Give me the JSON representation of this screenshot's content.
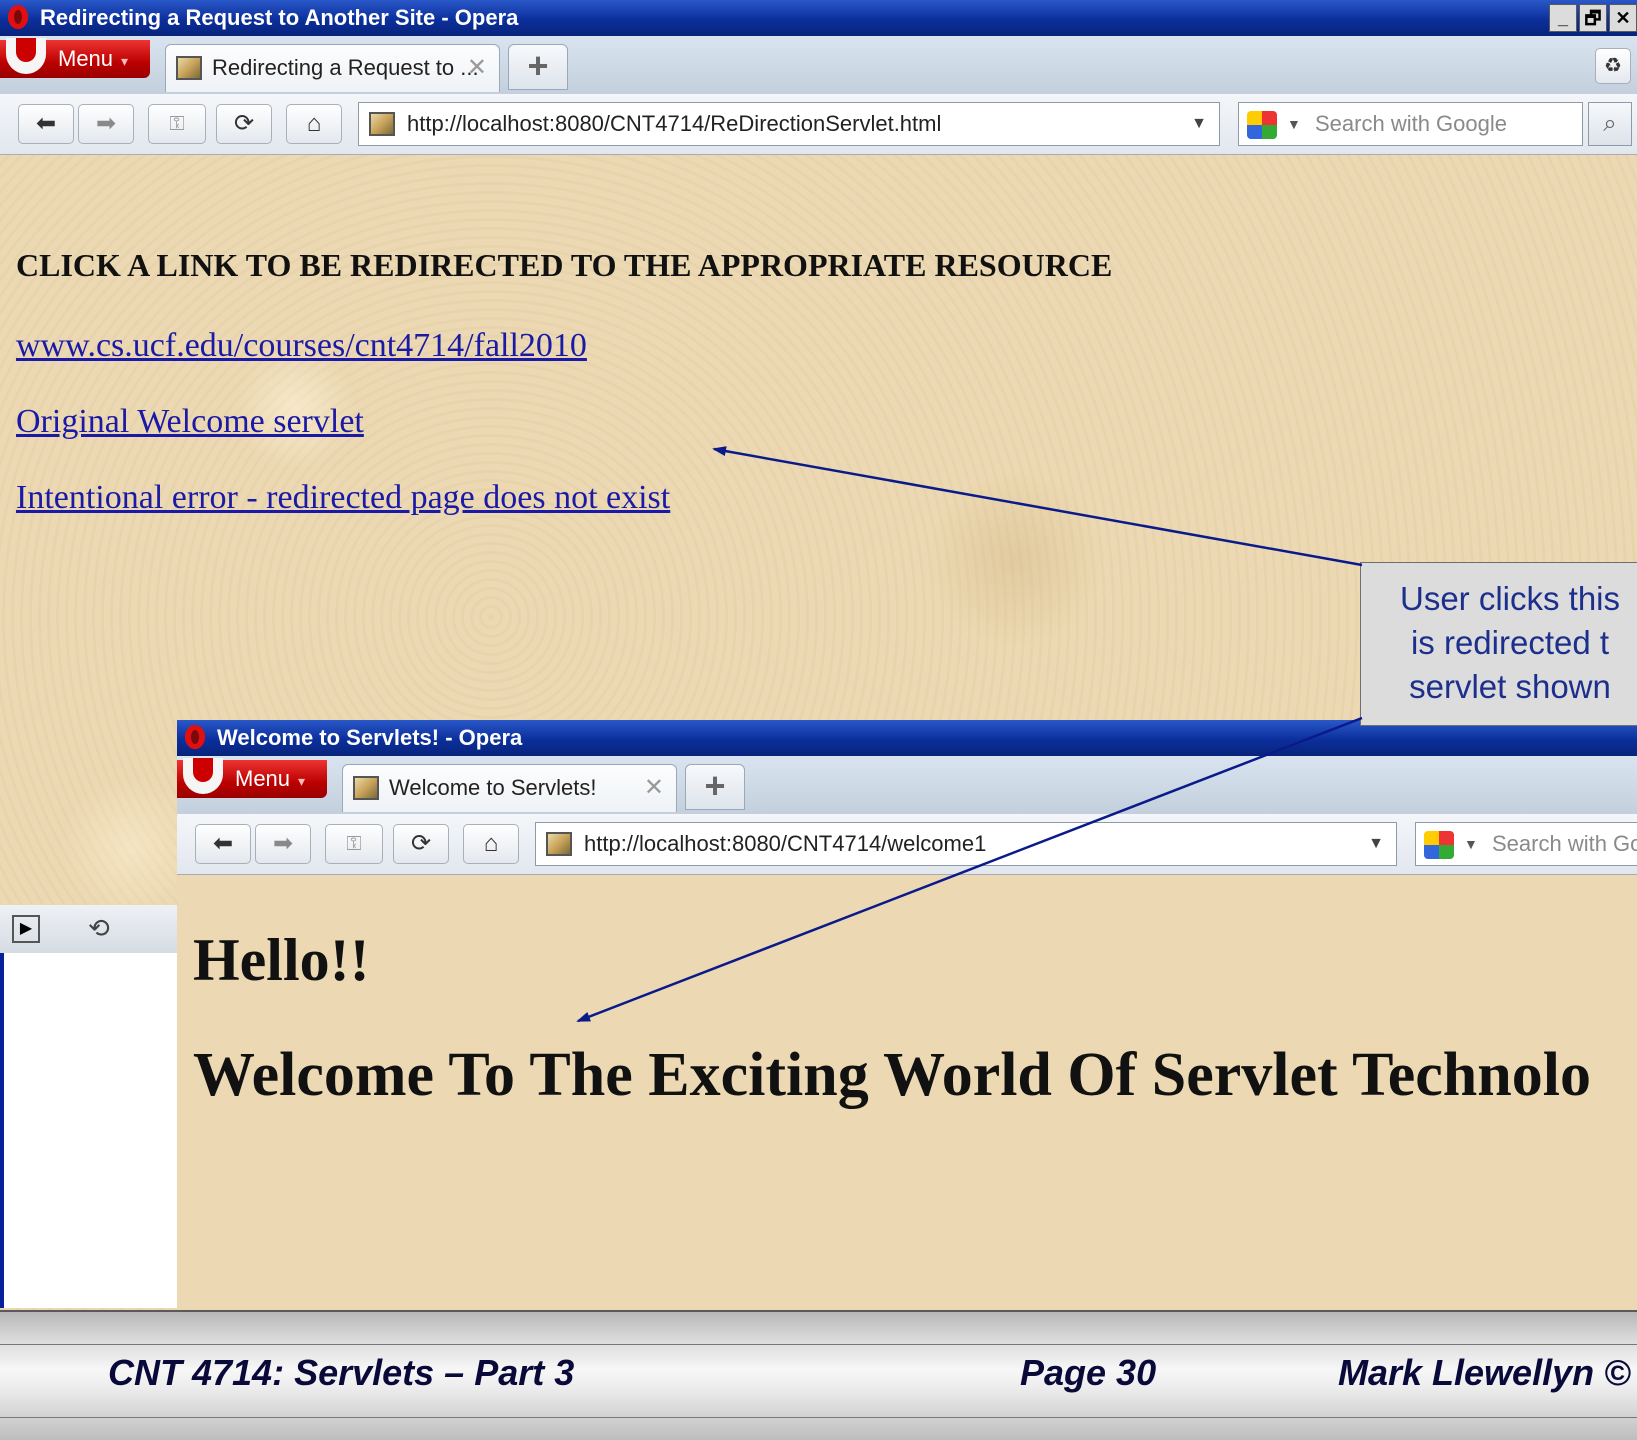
{
  "window1": {
    "title": "Redirecting a Request to Another Site - Opera",
    "window_buttons": [
      "_",
      "🗗",
      "✕"
    ],
    "menu_label": "Menu",
    "tab_title": "Redirecting a Request to ...",
    "address": "http://localhost:8080/CNT4714/ReDirectionServlet.html",
    "search_placeholder": "Search with Google",
    "heading": "CLICK A LINK TO BE REDIRECTED TO THE APPROPRIATE RESOURCE",
    "links": [
      "www.cs.ucf.edu/courses/cnt4714/fall2010",
      "Original Welcome servlet",
      "Intentional error - redirected page does not exist"
    ]
  },
  "callout": {
    "lines": [
      "User clicks this",
      "is redirected t",
      "servlet shown"
    ]
  },
  "window2": {
    "title": "Welcome to Servlets! - Opera",
    "menu_label": "Menu",
    "tab_title": "Welcome to Servlets!",
    "address": "http://localhost:8080/CNT4714/welcome1",
    "search_placeholder": "Search with Go",
    "hello": "Hello!!",
    "welcome": "Welcome To The Exciting World Of Servlet Technolo"
  },
  "footer": {
    "course": "CNT 4714: Servlets – Part 3",
    "page": "Page 30",
    "author": "Mark Llewellyn ©"
  },
  "colors": {
    "titlebar": "#0b2f9c",
    "link": "#1a1aa6",
    "callout_text": "#1c2f8c",
    "arrow": "#0a1a8a"
  }
}
